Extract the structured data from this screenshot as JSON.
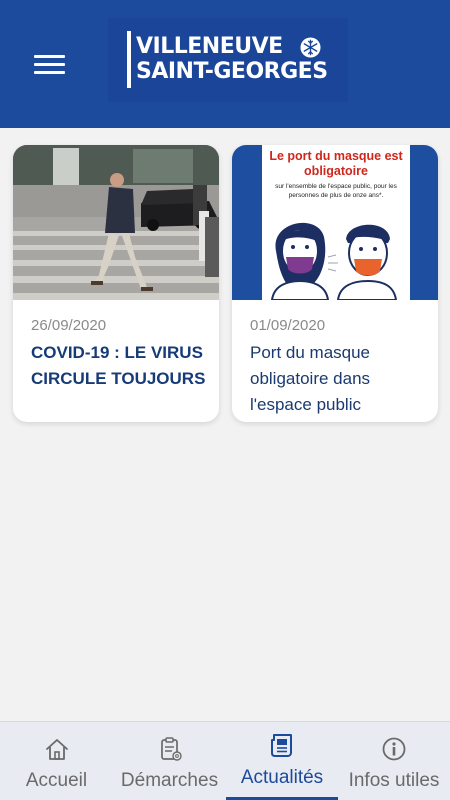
{
  "header": {
    "logo_line1": "VILLENEUVE",
    "logo_line2": "SAINT-GEORGES"
  },
  "articles": [
    {
      "date": "26/09/2020",
      "title": "COVID-19 : LE VIRUS CIRCULE TOUJOURS"
    },
    {
      "date": "01/09/2020",
      "title": "Port du masque obligatoire dans l'espace public",
      "poster_title": "Le port du masque est obligatoire",
      "poster_subtitle": "sur l'ensemble de l'espace public, pour les personnes de plus de onze ans*."
    }
  ],
  "bottom_nav": {
    "items": [
      {
        "label": "Accueil",
        "icon": "home-icon"
      },
      {
        "label": "Démarches",
        "icon": "clipboard-icon"
      },
      {
        "label": "Actualités",
        "icon": "newspaper-icon",
        "active": true
      },
      {
        "label": "Infos utiles",
        "icon": "info-icon"
      }
    ]
  },
  "colors": {
    "brand_blue": "#1c4a9c",
    "background": "#f2f2f2",
    "title_text": "#173b78",
    "date_text": "#8a8a8a",
    "poster_red": "#d0261c"
  }
}
